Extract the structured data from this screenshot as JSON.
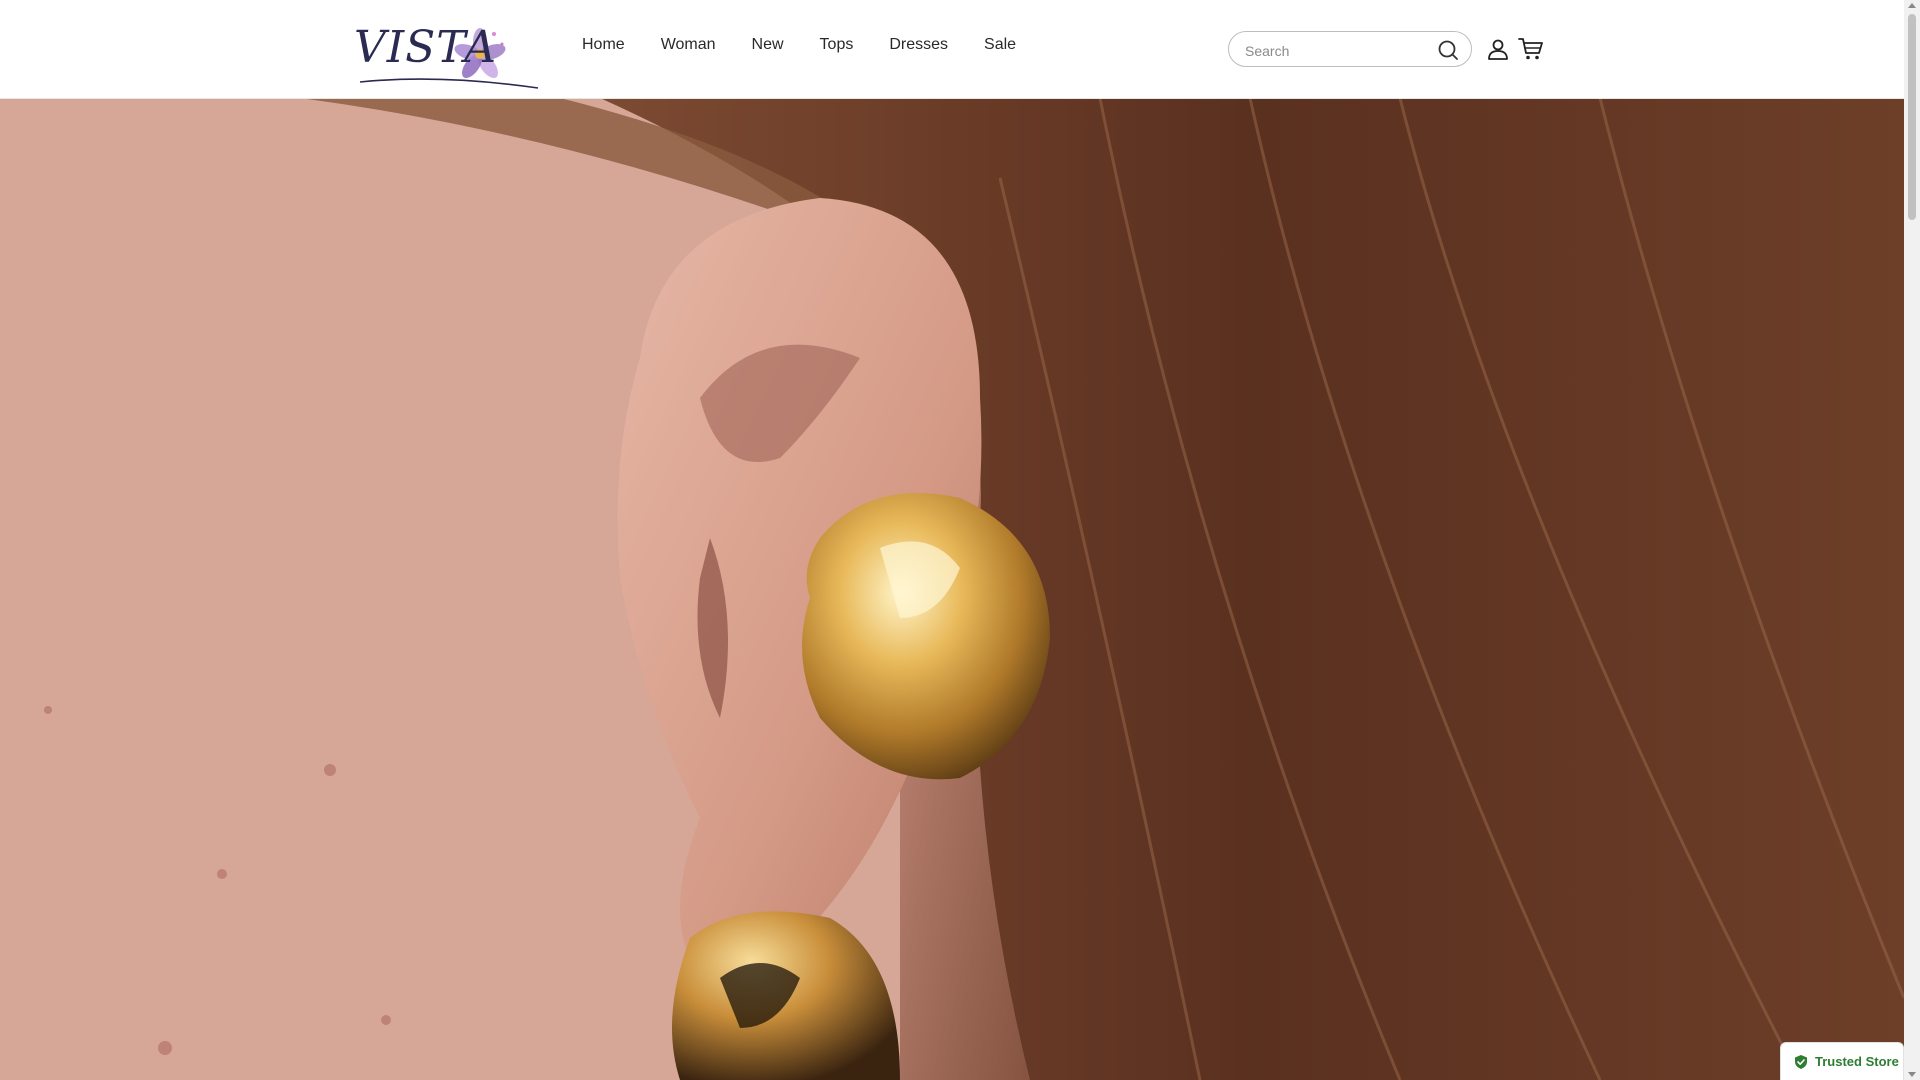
{
  "brand": {
    "logo_text": "VISTA"
  },
  "nav": {
    "items": [
      {
        "label": "Home"
      },
      {
        "label": "Woman"
      },
      {
        "label": "New"
      },
      {
        "label": "Tops"
      },
      {
        "label": "Dresses"
      },
      {
        "label": "Sale"
      }
    ]
  },
  "search": {
    "placeholder": "Search",
    "value": ""
  },
  "icons": {
    "search": "search-icon",
    "user": "user-icon",
    "cart": "cart-icon",
    "shield": "shield-check-icon"
  },
  "badge": {
    "label": "Trusted Store"
  },
  "colors": {
    "accent": "#2e7d32",
    "logo": "#2b2a52",
    "gold": "#d4a24a"
  }
}
